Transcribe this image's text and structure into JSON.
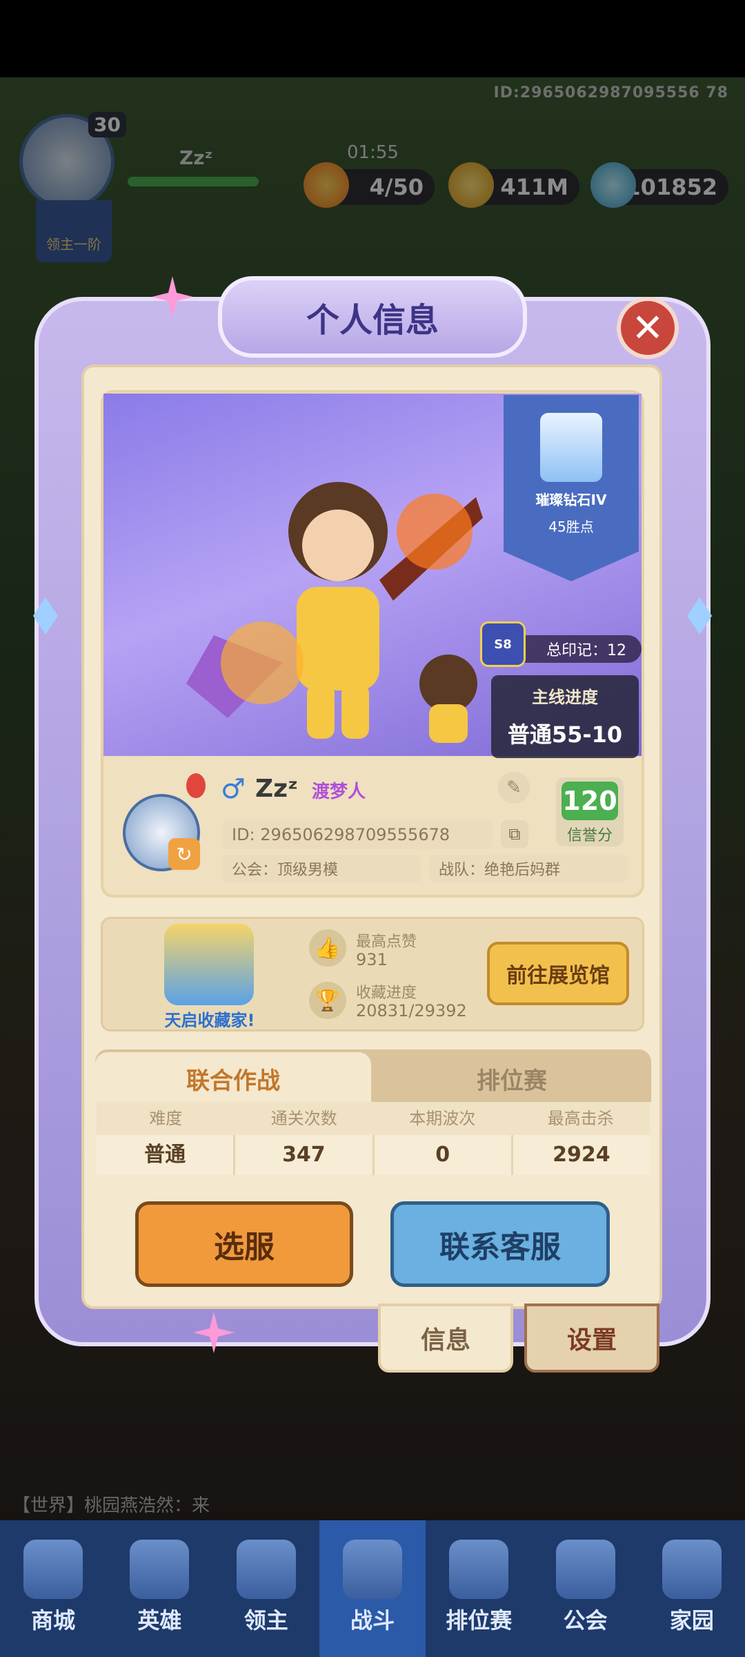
{
  "hud": {
    "player_id": "ID:2965062987095556 78",
    "level": "30",
    "name": "Zzᶻ",
    "rank_badge": "领主一阶",
    "timer": "01:55",
    "stamina": "4/50",
    "gold": "411M",
    "gems": "101852"
  },
  "panel": {
    "title": "个人信息",
    "close_symbol": "✕",
    "rank_name": "璀璨钻石IV",
    "rank_points": "45胜点",
    "total_marks": "总印记：12",
    "s8_badge": "S8",
    "progress_title": "主线进度",
    "progress_value": "普通55-10",
    "profile": {
      "gender": "♂",
      "name": "Zzᶻ",
      "title": "渡梦人",
      "id": "ID:  296506298709555678",
      "guild": "公会：顶级男模",
      "team": "战队：绝艳后妈群",
      "credit_value": "120",
      "credit_label": "信誉分",
      "refresh_icon": "↻",
      "feather_icon": "✎",
      "copy_icon": "⧉"
    },
    "collection": {
      "badge_label": "天启收藏家!",
      "likes_label": "最高点赞",
      "likes_value": "931",
      "progress_label": "收藏进度",
      "progress_value": "20831/29392",
      "gallery_button": "前往展览馆",
      "like_icon": "👍",
      "trophy_icon": "🏆"
    },
    "tabs": [
      "联合作战",
      "排位赛"
    ],
    "table": {
      "headers": [
        "难度",
        "通关次数",
        "本期波次",
        "最高击杀"
      ],
      "row": [
        "普通",
        "347",
        "0",
        "2924"
      ]
    },
    "buttons": {
      "select_server": "选服",
      "contact_service": "联系客服"
    },
    "side_tabs": [
      "信息",
      "设置"
    ]
  },
  "chat": "【世界】桃园燕浩然：来",
  "nav": [
    "商城",
    "英雄",
    "领主",
    "战斗",
    "排位赛",
    "公会",
    "家园"
  ]
}
